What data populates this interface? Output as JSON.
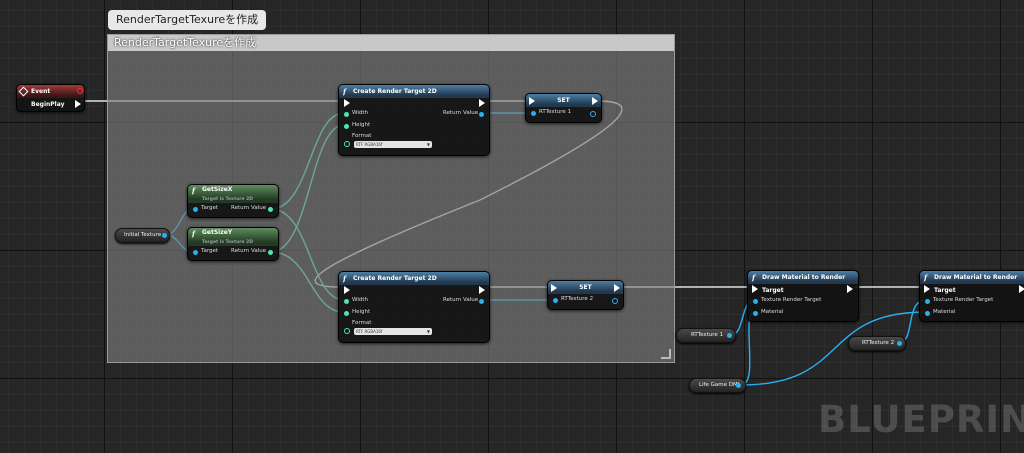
{
  "graph": {
    "watermark": "BLUEPRINT",
    "comment": {
      "bubble": "RenderTargetTexureを作成",
      "title": "RenderTargetTexureを作成"
    }
  },
  "nodes": {
    "event_begin_play": {
      "title": "Event BeginPlay"
    },
    "create_rt_1": {
      "title": "Create Render Target 2D",
      "width": "Width",
      "height": "Height",
      "format_label": "Format",
      "format_value": "RTF RGBA16f",
      "return_value": "Return Value"
    },
    "create_rt_2": {
      "title": "Create Render Target 2D",
      "width": "Width",
      "height": "Height",
      "format_label": "Format",
      "format_value": "RTF RGBA16f",
      "return_value": "Return Value"
    },
    "set_1": {
      "title": "SET",
      "var": "RTTexture 1"
    },
    "set_2": {
      "title": "SET",
      "var": "RTTexture 2"
    },
    "get_size_x": {
      "title": "GetSizeX",
      "subtitle": "Target is Texture 2D",
      "target": "Target",
      "return_value": "Return Value"
    },
    "get_size_y": {
      "title": "GetSizeY",
      "subtitle": "Target is Texture 2D",
      "target": "Target",
      "return_value": "Return Value"
    },
    "initial_texture": {
      "label": "Initial Texture"
    },
    "draw_material_1": {
      "title": "Draw Material to Render Target",
      "texture_target": "Texture Render Target",
      "material": "Material"
    },
    "draw_material_2": {
      "title": "Draw Material to Render Target",
      "texture_target": "Texture Render Target",
      "material": "Material"
    },
    "rttexture_1_get": {
      "label": "RTTexture 1"
    },
    "rttexture_2_get": {
      "label": "RTTexture 2"
    },
    "life_game_dmi": {
      "label": "Life Game DMI"
    }
  },
  "colors": {
    "exec": "#ffffff",
    "int_pin": "#4de8b0",
    "object_pin": "#2ab0f0",
    "event_header": "#a23a3a",
    "function_header": "#4d7fa6",
    "pure_header": "#5f8c5f"
  }
}
